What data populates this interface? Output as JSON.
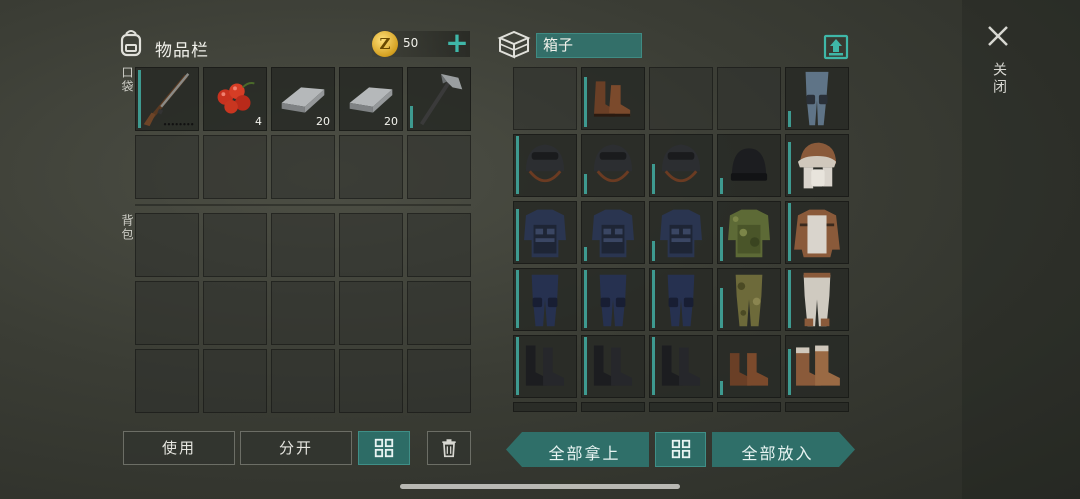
{
  "inventory": {
    "title": "物品栏",
    "pocket_label": "口袋",
    "backpack_label": "背包",
    "coins": "50",
    "coin_symbol": "Z",
    "pocket_items": [
      {
        "icon": "rifle-icon",
        "qty": ""
      },
      {
        "icon": "berries-icon",
        "qty": "4"
      },
      {
        "icon": "iron-ingot-icon",
        "qty": "20"
      },
      {
        "icon": "iron-ingot-icon",
        "qty": "20"
      },
      {
        "icon": "hatchet-icon",
        "qty": ""
      }
    ]
  },
  "container": {
    "name": "箱子",
    "items": [
      [
        "empty",
        "boots-icon",
        "empty",
        "empty",
        "leg-guard-icon"
      ],
      [
        "helmet-icon",
        "helmet-icon",
        "helmet-icon",
        "beanie-icon",
        "ushanka-icon"
      ],
      [
        "police-vest-icon",
        "police-vest-icon",
        "police-vest-icon",
        "camo-vest-icon",
        "leather-jacket-icon"
      ],
      [
        "police-pants-icon",
        "police-pants-icon",
        "police-pants-icon",
        "camo-pants-icon",
        "white-pants-icon"
      ],
      [
        "black-boots-icon",
        "black-boots-icon",
        "black-boots-icon",
        "brown-boots-icon",
        "winter-boots-icon"
      ]
    ]
  },
  "buttons": {
    "use": "使用",
    "split": "分开",
    "take_all": "全部拿上",
    "put_all": "全部放入"
  },
  "close_label": "关闭",
  "colors": {
    "accent": "#2d6c66",
    "accent_bright": "#3fb7a8",
    "durability": "#3e9a90"
  }
}
